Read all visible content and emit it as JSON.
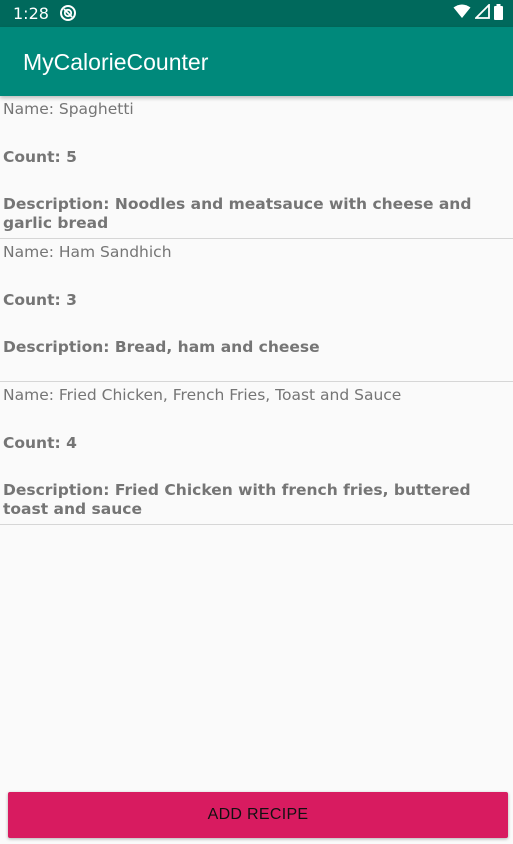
{
  "status_bar": {
    "time": "1:28",
    "icons": [
      "sync-icon",
      "wifi-icon",
      "signal-icon",
      "battery-icon"
    ]
  },
  "app_bar": {
    "title": "MyCalorieCounter"
  },
  "recipes": [
    {
      "name": "Name: Spaghetti",
      "count": "Count: 5",
      "description": "Description: Noodles and meatsauce with cheese and garlic bread"
    },
    {
      "name": "Name: Ham Sandhich",
      "count": "Count: 3",
      "description": "Description: Bread, ham and cheese"
    },
    {
      "name": "Name: Fried Chicken, French Fries, Toast and Sauce",
      "count": "Count: 4",
      "description": "Description: Fried Chicken with french fries, buttered toast and sauce"
    }
  ],
  "actions": {
    "add_recipe_label": "ADD RECIPE"
  },
  "colors": {
    "status_bar": "#00695c",
    "app_bar": "#00897b",
    "accent": "#d81b60",
    "text_secondary": "#757575",
    "background": "#fafafa"
  }
}
